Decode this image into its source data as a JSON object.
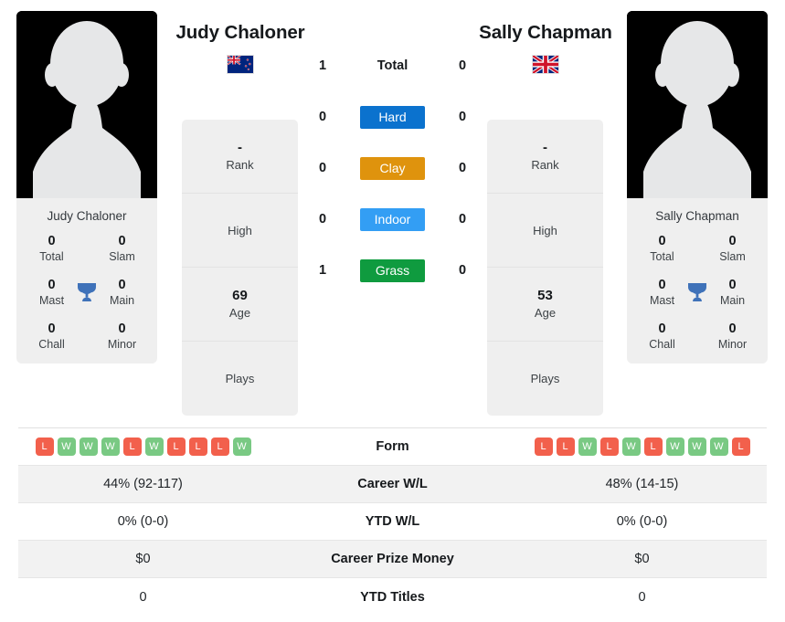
{
  "players": {
    "left": {
      "name": "Judy Chaloner",
      "flag": "new-zealand-flag",
      "card_name": "Judy Chaloner",
      "titles": [
        {
          "value": "0",
          "label": "Total"
        },
        {
          "value": "0",
          "label": "Slam"
        },
        {
          "value": "0",
          "label": "Mast"
        },
        {
          "value": "0",
          "label": "Main"
        },
        {
          "value": "0",
          "label": "Chall"
        },
        {
          "value": "0",
          "label": "Minor"
        }
      ],
      "info": [
        {
          "value": "-",
          "label": "Rank"
        },
        {
          "value": "",
          "label": "High"
        },
        {
          "value": "69",
          "label": "Age"
        },
        {
          "value": "",
          "label": "Plays"
        }
      ]
    },
    "right": {
      "name": "Sally Chapman",
      "flag": "united-kingdom-flag",
      "card_name": "Sally Chapman",
      "titles": [
        {
          "value": "0",
          "label": "Total"
        },
        {
          "value": "0",
          "label": "Slam"
        },
        {
          "value": "0",
          "label": "Mast"
        },
        {
          "value": "0",
          "label": "Main"
        },
        {
          "value": "0",
          "label": "Chall"
        },
        {
          "value": "0",
          "label": "Minor"
        }
      ],
      "info": [
        {
          "value": "-",
          "label": "Rank"
        },
        {
          "value": "",
          "label": "High"
        },
        {
          "value": "53",
          "label": "Age"
        },
        {
          "value": "",
          "label": "Plays"
        }
      ]
    }
  },
  "surfaces": [
    {
      "label": "Total",
      "left": "1",
      "right": "0",
      "color": "",
      "badge": false
    },
    {
      "label": "Hard",
      "left": "0",
      "right": "0",
      "color": "#0b72ce",
      "badge": true
    },
    {
      "label": "Clay",
      "left": "0",
      "right": "0",
      "color": "#df930d",
      "badge": true
    },
    {
      "label": "Indoor",
      "left": "0",
      "right": "0",
      "color": "#339ef4",
      "badge": true
    },
    {
      "label": "Grass",
      "left": "1",
      "right": "0",
      "color": "#0f9b3f",
      "badge": true
    }
  ],
  "form": {
    "label": "Form",
    "win_color": "#79c983",
    "loss_color": "#f2604c",
    "left": [
      "L",
      "W",
      "W",
      "W",
      "L",
      "W",
      "L",
      "L",
      "L",
      "W"
    ],
    "right": [
      "L",
      "L",
      "W",
      "L",
      "W",
      "L",
      "W",
      "W",
      "W",
      "L"
    ]
  },
  "stats_rows": [
    {
      "label": "Career W/L",
      "left": "44% (92-117)",
      "right": "48% (14-15)"
    },
    {
      "label": "YTD W/L",
      "left": "0% (0-0)",
      "right": "0% (0-0)"
    },
    {
      "label": "Career Prize Money",
      "left": "$0",
      "right": "$0"
    },
    {
      "label": "YTD Titles",
      "left": "0",
      "right": "0"
    }
  ]
}
